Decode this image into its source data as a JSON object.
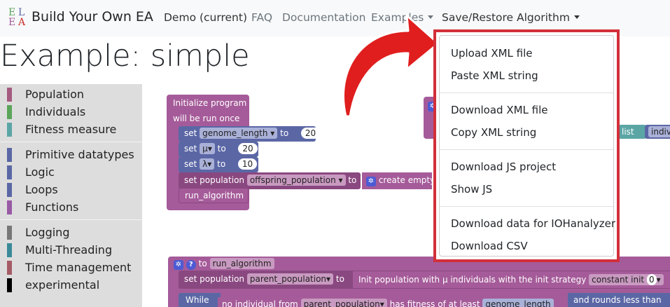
{
  "navbar": {
    "logo_letters": [
      "E",
      "L",
      "E",
      "A"
    ],
    "brand": "Build Your Own EA",
    "links": {
      "demo": "Demo (current)",
      "faq": "FAQ",
      "documentation": "Documentation",
      "examples": "Examples",
      "save_restore": "Save/Restore Algorithm"
    }
  },
  "page_title": "Example: simple",
  "toolbox": {
    "items": [
      {
        "label": "Population",
        "color": "#a55b80"
      },
      {
        "label": "Individuals",
        "color": "#5ba55b"
      },
      {
        "label": "Fitness measure",
        "color": "#5ba5a5"
      },
      {
        "label": "Primitive datatypes",
        "color": "#5b67a5"
      },
      {
        "label": "Logic",
        "color": "#5b67a5"
      },
      {
        "label": "Loops",
        "color": "#5b67a5"
      },
      {
        "label": "Functions",
        "color": "#995ba5"
      },
      {
        "label": "Logging",
        "color": "#777777"
      },
      {
        "label": "Multi-Threading",
        "color": "#3a8a99"
      },
      {
        "label": "Time management",
        "color": "#a55b67"
      },
      {
        "label": "experimental",
        "color": "#000000"
      }
    ]
  },
  "workspace": {
    "init_block": {
      "line1": "Initialize program",
      "line2": "will be run once",
      "rows": [
        {
          "set": "set",
          "var": "genome_length",
          "to": "to",
          "value": "20"
        },
        {
          "set": "set",
          "var": "μ",
          "to": "to",
          "value": "20"
        },
        {
          "set": "set",
          "var": "λ",
          "to": "to",
          "value": "10"
        }
      ],
      "set_population": "set population",
      "offspring_var": "offspring_population",
      "to": "to",
      "create_empty": "create empty",
      "run_algorithm": "run_algorithm"
    },
    "list_label": "list",
    "indiv_label": "indivi",
    "func_block": {
      "to": "to",
      "name": "run_algorithm",
      "set_population": "set population",
      "parent_var": "parent_population",
      "to2": "to",
      "init_text": "Init population with μ individuals  with the init strategy",
      "constant_init": "constant init",
      "constant_value": "0",
      "while": "While",
      "no_individual": "no individual from",
      "parent_var2": "parent_population",
      "has_fitness": "has fitness of at least",
      "genome_length": "genome_length",
      "and_rounds": "and rounds less than"
    }
  },
  "dropdown": {
    "groups": [
      [
        "Upload XML file",
        "Paste XML string"
      ],
      [
        "Download XML file",
        "Copy XML string"
      ],
      [
        "Download JS project",
        "Show JS"
      ],
      [
        "Download data for IOHanalyzer",
        "Download CSV"
      ]
    ],
    "highlight_color": "#d32f3a"
  }
}
